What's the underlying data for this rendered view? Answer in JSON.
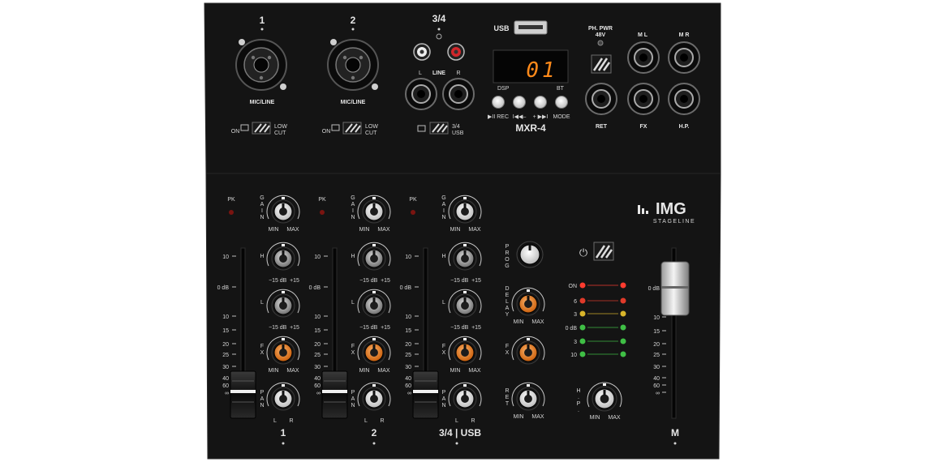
{
  "brand": {
    "logo": "IMG",
    "sub": "STAGELINE"
  },
  "model": "MXR-4",
  "top": {
    "ch1_label": "1",
    "ch2_label": "2",
    "ch34_label": "3/4",
    "input_label": "MIC/LINE",
    "line_label": "LINE",
    "line_l": "L",
    "line_r": "R",
    "on_label": "ON",
    "lowcut_1": "LOW",
    "lowcut_2": "CUT",
    "src_34": "3/4",
    "src_usb": "USB",
    "usb_label": "USB",
    "display_value": "01",
    "dsp_label": "DSP",
    "bt_label": "BT",
    "rec_label": "▶II REC",
    "prev_label": "I◀◀–",
    "next_label": "+ ▶▶I",
    "mode_label": "MODE",
    "phantom_1": "PH. PWR",
    "phantom_2": "48V",
    "ml_label": "M L",
    "mr_label": "M R",
    "ret_label": "RET",
    "fx_label": "FX",
    "hp_label": "H.P."
  },
  "strip": {
    "pk": "PK",
    "gain": "GAIN",
    "min": "MIN",
    "max": "MAX",
    "h": "H",
    "l": "L",
    "fx": "FX",
    "pan": "PAN",
    "eq_minus": "−15",
    "eq_db": "dB",
    "eq_plus": "+15",
    "pan_l": "L",
    "pan_r": "R"
  },
  "fader_scale": [
    "10",
    "0 dB",
    "10",
    "15",
    "20",
    "25",
    "30",
    "40",
    "60",
    "∞"
  ],
  "channels": [
    {
      "label": "1"
    },
    {
      "label": "2"
    },
    {
      "label": "3/4 | USB"
    }
  ],
  "fx_section": {
    "prog": "PROG",
    "delay": "DELAY",
    "fx": "FX",
    "ret": "RET",
    "min": "MIN",
    "max": "MAX"
  },
  "meter": {
    "labels": [
      "ON",
      "6",
      "3",
      "0 dB",
      "3",
      "10"
    ],
    "colors": [
      "#ff3b2f",
      "#e03a2a",
      "#d9b52a",
      "#3fbf45",
      "#3fbf45",
      "#3fbf45"
    ]
  },
  "hp_knob": {
    "label": "H.P.",
    "min": "MIN",
    "max": "MAX"
  },
  "master": {
    "label": "M",
    "scale": [
      "0 dB",
      "10",
      "15",
      "20",
      "25",
      "30",
      "40",
      "60",
      "∞"
    ]
  },
  "accent": {
    "orange": "#e07a1f",
    "panel": "#151515"
  }
}
